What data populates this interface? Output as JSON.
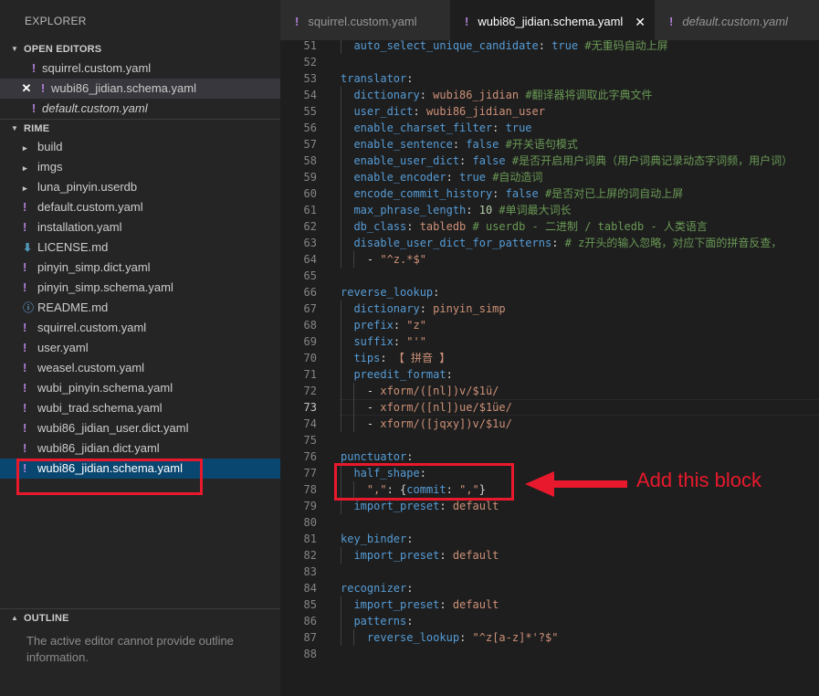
{
  "sidebar": {
    "title": "EXPLORER",
    "open_editors_label": "OPEN EDITORS",
    "open_editors": [
      {
        "glyph": "!",
        "name": "squirrel.custom.yaml",
        "italic": false
      },
      {
        "glyph": "✕ !",
        "name": "wubi86_jidian.schema.yaml",
        "italic": false
      },
      {
        "glyph": "!",
        "name": "default.custom.yaml",
        "italic": true
      }
    ],
    "root_label": "RIME",
    "files": [
      {
        "icon": "chevron-right-icon",
        "glyph": "▸",
        "name": "build"
      },
      {
        "icon": "chevron-right-icon",
        "glyph": "▸",
        "name": "imgs"
      },
      {
        "icon": "chevron-right-icon",
        "glyph": "▸",
        "name": "luna_pinyin.userdb"
      },
      {
        "icon": "yaml-icon",
        "glyph": "!",
        "name": "default.custom.yaml"
      },
      {
        "icon": "yaml-icon",
        "glyph": "!",
        "name": "installation.yaml"
      },
      {
        "icon": "download-icon",
        "glyph": "⬇",
        "name": "LICENSE.md"
      },
      {
        "icon": "yaml-icon",
        "glyph": "!",
        "name": "pinyin_simp.dict.yaml"
      },
      {
        "icon": "yaml-icon",
        "glyph": "!",
        "name": "pinyin_simp.schema.yaml"
      },
      {
        "icon": "info-icon",
        "glyph": "ⓘ",
        "name": "README.md"
      },
      {
        "icon": "yaml-icon",
        "glyph": "!",
        "name": "squirrel.custom.yaml"
      },
      {
        "icon": "yaml-icon",
        "glyph": "!",
        "name": "user.yaml"
      },
      {
        "icon": "yaml-icon",
        "glyph": "!",
        "name": "weasel.custom.yaml"
      },
      {
        "icon": "yaml-icon",
        "glyph": "!",
        "name": "wubi_pinyin.schema.yaml"
      },
      {
        "icon": "yaml-icon",
        "glyph": "!",
        "name": "wubi_trad.schema.yaml"
      },
      {
        "icon": "yaml-icon",
        "glyph": "!",
        "name": "wubi86_jidian_user.dict.yaml"
      },
      {
        "icon": "yaml-icon",
        "glyph": "!",
        "name": "wubi86_jidian.dict.yaml"
      },
      {
        "icon": "yaml-icon",
        "glyph": "!",
        "name": "wubi86_jidian.schema.yaml",
        "selected": true
      }
    ],
    "outline_label": "OUTLINE",
    "outline_message": "The active editor cannot provide outline information."
  },
  "tabs": [
    {
      "name": "squirrel.custom.yaml",
      "active": false,
      "italic": false
    },
    {
      "name": "wubi86_jidian.schema.yaml",
      "active": true,
      "italic": false,
      "close": "✕"
    },
    {
      "name": "default.custom.yaml",
      "active": false,
      "italic": true
    }
  ],
  "editor": {
    "current_line": 73,
    "lines": [
      {
        "n": 51,
        "indent": 1,
        "segs": [
          [
            "k",
            "auto_select_unique_candidate"
          ],
          [
            "p",
            ": "
          ],
          [
            "k",
            "true"
          ],
          [
            "p",
            " "
          ],
          [
            "c",
            "#无重码自动上屏"
          ]
        ]
      },
      {
        "n": 52,
        "indent": 0,
        "segs": []
      },
      {
        "n": 53,
        "indent": 0,
        "segs": [
          [
            "k",
            "translator"
          ],
          [
            "p",
            ":"
          ]
        ]
      },
      {
        "n": 54,
        "indent": 1,
        "segs": [
          [
            "k",
            "dictionary"
          ],
          [
            "p",
            ": "
          ],
          [
            "s",
            "wubi86_jidian"
          ],
          [
            "p",
            " "
          ],
          [
            "c",
            "#翻译器将调取此字典文件"
          ]
        ]
      },
      {
        "n": 55,
        "indent": 1,
        "segs": [
          [
            "k",
            "user_dict"
          ],
          [
            "p",
            ": "
          ],
          [
            "s",
            "wubi86_jidian_user"
          ]
        ]
      },
      {
        "n": 56,
        "indent": 1,
        "segs": [
          [
            "k",
            "enable_charset_filter"
          ],
          [
            "p",
            ": "
          ],
          [
            "k",
            "true"
          ]
        ]
      },
      {
        "n": 57,
        "indent": 1,
        "segs": [
          [
            "k",
            "enable_sentence"
          ],
          [
            "p",
            ": "
          ],
          [
            "k",
            "false"
          ],
          [
            "p",
            " "
          ],
          [
            "c",
            "#开关语句模式"
          ]
        ]
      },
      {
        "n": 58,
        "indent": 1,
        "segs": [
          [
            "k",
            "enable_user_dict"
          ],
          [
            "p",
            ": "
          ],
          [
            "k",
            "false"
          ],
          [
            "p",
            " "
          ],
          [
            "c",
            "#是否开启用户词典（用户词典记录动态字词频，用户词）"
          ]
        ]
      },
      {
        "n": 59,
        "indent": 1,
        "segs": [
          [
            "k",
            "enable_encoder"
          ],
          [
            "p",
            ": "
          ],
          [
            "k",
            "true"
          ],
          [
            "p",
            " "
          ],
          [
            "c",
            "#自动造词"
          ]
        ]
      },
      {
        "n": 60,
        "indent": 1,
        "segs": [
          [
            "k",
            "encode_commit_history"
          ],
          [
            "p",
            ": "
          ],
          [
            "k",
            "false"
          ],
          [
            "p",
            " "
          ],
          [
            "c",
            "#是否对已上屏的词自动上屏"
          ]
        ]
      },
      {
        "n": 61,
        "indent": 1,
        "segs": [
          [
            "k",
            "max_phrase_length"
          ],
          [
            "p",
            ": "
          ],
          [
            "n",
            "10"
          ],
          [
            "p",
            " "
          ],
          [
            "c",
            "#单词最大词长"
          ]
        ]
      },
      {
        "n": 62,
        "indent": 1,
        "segs": [
          [
            "k",
            "db_class"
          ],
          [
            "p",
            ": "
          ],
          [
            "s",
            "tabledb"
          ],
          [
            "p",
            " "
          ],
          [
            "c",
            "# userdb - 二进制 / tabledb - 人类语言"
          ]
        ]
      },
      {
        "n": 63,
        "indent": 1,
        "segs": [
          [
            "k",
            "disable_user_dict_for_patterns"
          ],
          [
            "p",
            ": "
          ],
          [
            "c",
            "# z开头的输入忽略，对应下面的拼音反查，"
          ]
        ]
      },
      {
        "n": 64,
        "indent": 2,
        "segs": [
          [
            "p",
            "- "
          ],
          [
            "s",
            "\"^z.*$\""
          ]
        ]
      },
      {
        "n": 65,
        "indent": 0,
        "segs": []
      },
      {
        "n": 66,
        "indent": 0,
        "segs": [
          [
            "k",
            "reverse_lookup"
          ],
          [
            "p",
            ":"
          ]
        ]
      },
      {
        "n": 67,
        "indent": 1,
        "segs": [
          [
            "k",
            "dictionary"
          ],
          [
            "p",
            ": "
          ],
          [
            "s",
            "pinyin_simp"
          ]
        ]
      },
      {
        "n": 68,
        "indent": 1,
        "segs": [
          [
            "k",
            "prefix"
          ],
          [
            "p",
            ": "
          ],
          [
            "s",
            "\"z\""
          ]
        ]
      },
      {
        "n": 69,
        "indent": 1,
        "segs": [
          [
            "k",
            "suffix"
          ],
          [
            "p",
            ": "
          ],
          [
            "s",
            "\"'\""
          ]
        ]
      },
      {
        "n": 70,
        "indent": 1,
        "segs": [
          [
            "k",
            "tips"
          ],
          [
            "p",
            ": "
          ],
          [
            "s",
            "【 拼音 】"
          ]
        ]
      },
      {
        "n": 71,
        "indent": 1,
        "segs": [
          [
            "k",
            "preedit_format"
          ],
          [
            "p",
            ":"
          ]
        ]
      },
      {
        "n": 72,
        "indent": 2,
        "segs": [
          [
            "p",
            "- "
          ],
          [
            "s",
            "xform/([nl])v/$1ü/"
          ]
        ]
      },
      {
        "n": 73,
        "indent": 2,
        "segs": [
          [
            "p",
            "- "
          ],
          [
            "s",
            "xform/([nl])ue/$1üe/"
          ]
        ]
      },
      {
        "n": 74,
        "indent": 2,
        "segs": [
          [
            "p",
            "- "
          ],
          [
            "s",
            "xform/([jqxy])v/$1u/"
          ]
        ]
      },
      {
        "n": 75,
        "indent": 0,
        "segs": []
      },
      {
        "n": 76,
        "indent": 0,
        "segs": [
          [
            "k",
            "punctuator"
          ],
          [
            "p",
            ":"
          ]
        ]
      },
      {
        "n": 77,
        "indent": 1,
        "segs": [
          [
            "k",
            "half_shape"
          ],
          [
            "p",
            ":"
          ]
        ]
      },
      {
        "n": 78,
        "indent": 2,
        "segs": [
          [
            "s",
            "\",\""
          ],
          [
            "p",
            ": {"
          ],
          [
            "k",
            "commit"
          ],
          [
            "p",
            ": "
          ],
          [
            "s",
            "\",\""
          ],
          [
            "p",
            "}"
          ]
        ]
      },
      {
        "n": 79,
        "indent": 1,
        "segs": [
          [
            "k",
            "import_preset"
          ],
          [
            "p",
            ": "
          ],
          [
            "s",
            "default"
          ]
        ]
      },
      {
        "n": 80,
        "indent": 0,
        "segs": []
      },
      {
        "n": 81,
        "indent": 0,
        "segs": [
          [
            "k",
            "key_binder"
          ],
          [
            "p",
            ":"
          ]
        ]
      },
      {
        "n": 82,
        "indent": 1,
        "segs": [
          [
            "k",
            "import_preset"
          ],
          [
            "p",
            ": "
          ],
          [
            "s",
            "default"
          ]
        ]
      },
      {
        "n": 83,
        "indent": 0,
        "segs": []
      },
      {
        "n": 84,
        "indent": 0,
        "segs": [
          [
            "k",
            "recognizer"
          ],
          [
            "p",
            ":"
          ]
        ]
      },
      {
        "n": 85,
        "indent": 1,
        "segs": [
          [
            "k",
            "import_preset"
          ],
          [
            "p",
            ": "
          ],
          [
            "s",
            "default"
          ]
        ]
      },
      {
        "n": 86,
        "indent": 1,
        "segs": [
          [
            "k",
            "patterns"
          ],
          [
            "p",
            ":"
          ]
        ]
      },
      {
        "n": 87,
        "indent": 2,
        "segs": [
          [
            "k",
            "reverse_lookup"
          ],
          [
            "p",
            ": "
          ],
          [
            "s",
            "\"^z[a-z]*'?$\""
          ]
        ]
      },
      {
        "n": 88,
        "indent": 0,
        "segs": []
      }
    ]
  },
  "annotation": {
    "label": "Add this block",
    "color": "#e8192c"
  }
}
